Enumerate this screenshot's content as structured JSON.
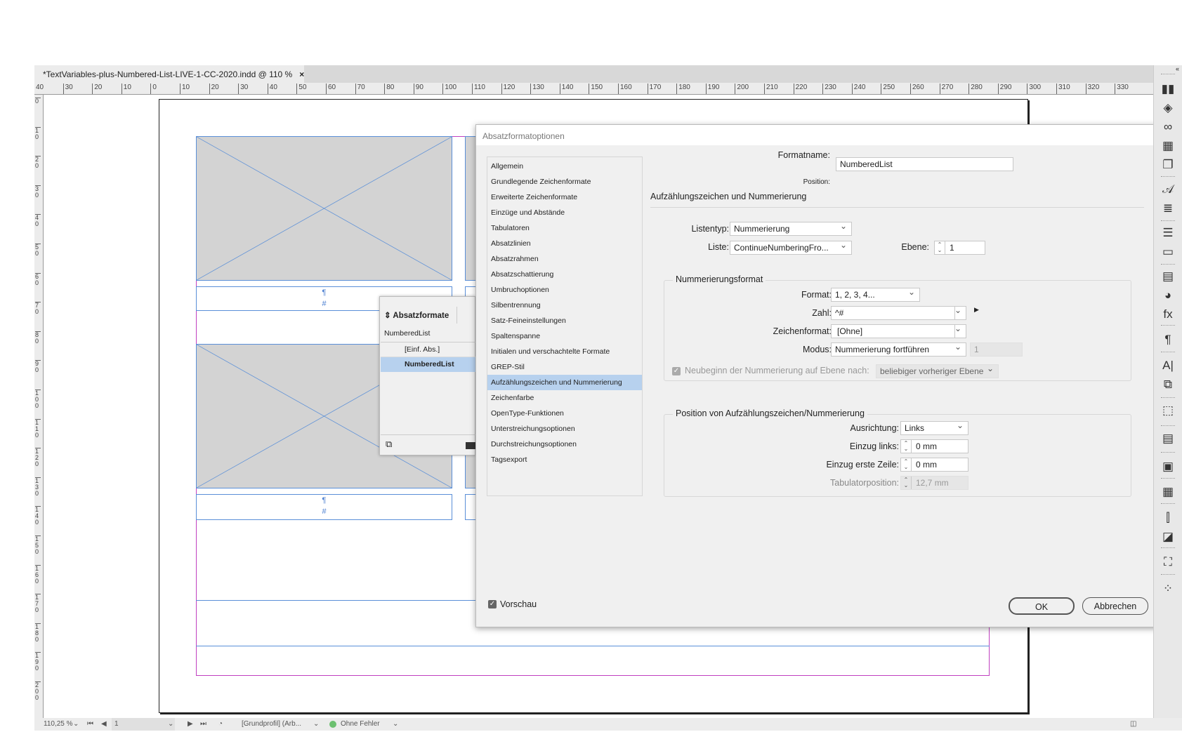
{
  "document_tab": {
    "title": "*TextVariables-plus-Numbered-List-LIVE-1-CC-2020.indd @ 110 %",
    "close": "×"
  },
  "ruler": {
    "horizontal": [
      "40",
      "30",
      "20",
      "10",
      "0",
      "10",
      "20",
      "30",
      "40",
      "50",
      "60",
      "70",
      "80",
      "90",
      "100",
      "110",
      "120",
      "130",
      "140",
      "150",
      "160",
      "170",
      "180",
      "190",
      "200",
      "210",
      "220",
      "230",
      "240",
      "250",
      "260",
      "270",
      "280",
      "290",
      "300",
      "310",
      "320",
      "330"
    ],
    "vertical": [
      "0",
      "10",
      "20",
      "30",
      "40",
      "50",
      "60",
      "70",
      "80",
      "90",
      "100",
      "110",
      "120",
      "130",
      "140",
      "150",
      "160",
      "170",
      "180",
      "190",
      "200"
    ]
  },
  "page": {
    "pilcrow": "¶",
    "number_marker": "#"
  },
  "styles_panel": {
    "title": "Absatzformate",
    "current": "NumberedList",
    "items": [
      "[Einf. Abs.]",
      "NumberedList"
    ],
    "selected_index": 1
  },
  "dialog": {
    "title": "Absatzformatoptionen",
    "nav": [
      "Allgemein",
      "Grundlegende Zeichenformate",
      "Erweiterte Zeichenformate",
      "Einzüge und Abstände",
      "Tabulatoren",
      "Absatzlinien",
      "Absatzrahmen",
      "Absatzschattierung",
      "Umbruchoptionen",
      "Silbentrennung",
      "Satz-Feineinstellungen",
      "Spaltenspanne",
      "Initialen und verschachtelte Formate",
      "GREP-Stil",
      "Aufzählungszeichen und Nummerierung",
      "Zeichenfarbe",
      "OpenType-Funktionen",
      "Unterstreichungsoptionen",
      "Durchstreichungsoptionen",
      "Tagsexport"
    ],
    "nav_selected": 14,
    "formatname_label": "Formatname:",
    "formatname_value": "NumberedList",
    "position_label": "Position:",
    "section_heading": "Aufzählungszeichen und Nummerierung",
    "listentyp_label": "Listentyp:",
    "listentyp_value": "Nummerierung",
    "liste_label": "Liste:",
    "liste_value": "ContinueNumberingFro...",
    "ebene_label": "Ebene:",
    "ebene_value": "1",
    "numbering_group": {
      "title": "Nummerierungsformat",
      "format_label": "Format:",
      "format_value": "1, 2, 3, 4...",
      "zahl_label": "Zahl:",
      "zahl_value": "^#",
      "zeichenformat_label": "Zeichenformat:",
      "zeichenformat_value": "[Ohne]",
      "modus_label": "Modus:",
      "modus_value": "Nummerierung fortführen",
      "modus_start": "1",
      "restart_label": "Neubeginn der Nummerierung auf Ebene nach:",
      "restart_checked": true,
      "restart_value": "beliebiger vorheriger Ebene"
    },
    "position_group": {
      "title": "Position von Aufzählungszeichen/Nummerierung",
      "ausrichtung_label": "Ausrichtung:",
      "ausrichtung_value": "Links",
      "einzug_links_label": "Einzug links:",
      "einzug_links_value": "0 mm",
      "einzug_erste_label": "Einzug erste Zeile:",
      "einzug_erste_value": "0 mm",
      "tab_label": "Tabulatorposition:",
      "tab_value": "12,7 mm"
    },
    "preview_label": "Vorschau",
    "preview_checked": true,
    "ok_label": "OK",
    "cancel_label": "Abbrechen"
  },
  "right_toolbar": [
    "pages-icon",
    "layers-icon",
    "links-icon",
    "swatches-icon",
    "cc-libraries-icon",
    "character-styles-icon",
    "stroke-icon",
    "lines-icon",
    "gradient-icon",
    "text-wrap-icon",
    "color-icon",
    "effects-icon",
    "paragraph-icon",
    "character-icon",
    "object-styles-icon",
    "frame-icon",
    "table-styles-icon",
    "cell-styles-icon",
    "table-icon",
    "align-icon",
    "pathfinder-icon",
    "transform-icon",
    "loading-icon"
  ],
  "status_bar": {
    "zoom": "110,25 %",
    "page": "1",
    "profile": "[Grundprofil] (Arb...",
    "preflight": "Ohne Fehler",
    "preflight_color": "#6cc070"
  }
}
